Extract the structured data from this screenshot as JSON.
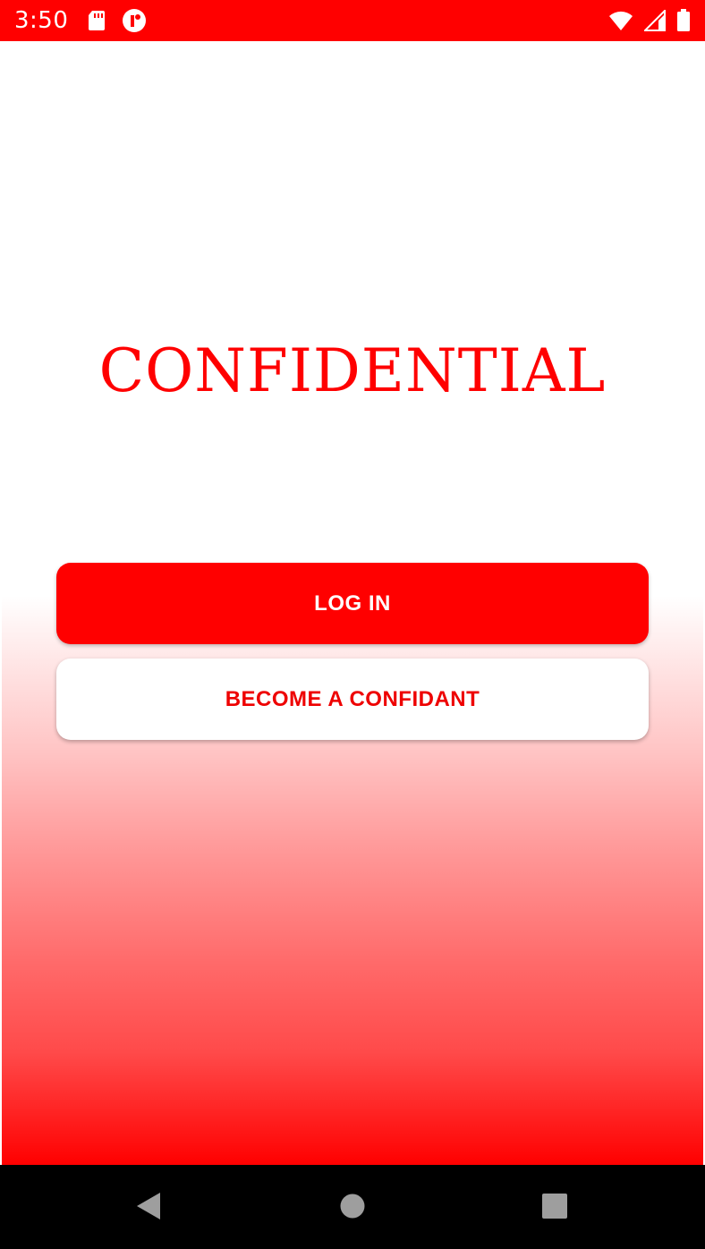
{
  "status_bar": {
    "time": "3:50",
    "background_color": "#ff0000",
    "icons_left": [
      "sd-card-icon",
      "app-notification-icon"
    ],
    "icons_right": [
      "wifi-icon",
      "cellular-signal-icon",
      "battery-icon"
    ]
  },
  "main": {
    "app_title": "CONFIDENTIAL",
    "login_button_label": "LOG IN",
    "become_confidant_button_label": "BECOME A CONFIDANT",
    "accent_color": "#ff0000"
  },
  "nav_bar": {
    "icons": [
      "back-icon",
      "home-icon",
      "recents-icon"
    ]
  }
}
